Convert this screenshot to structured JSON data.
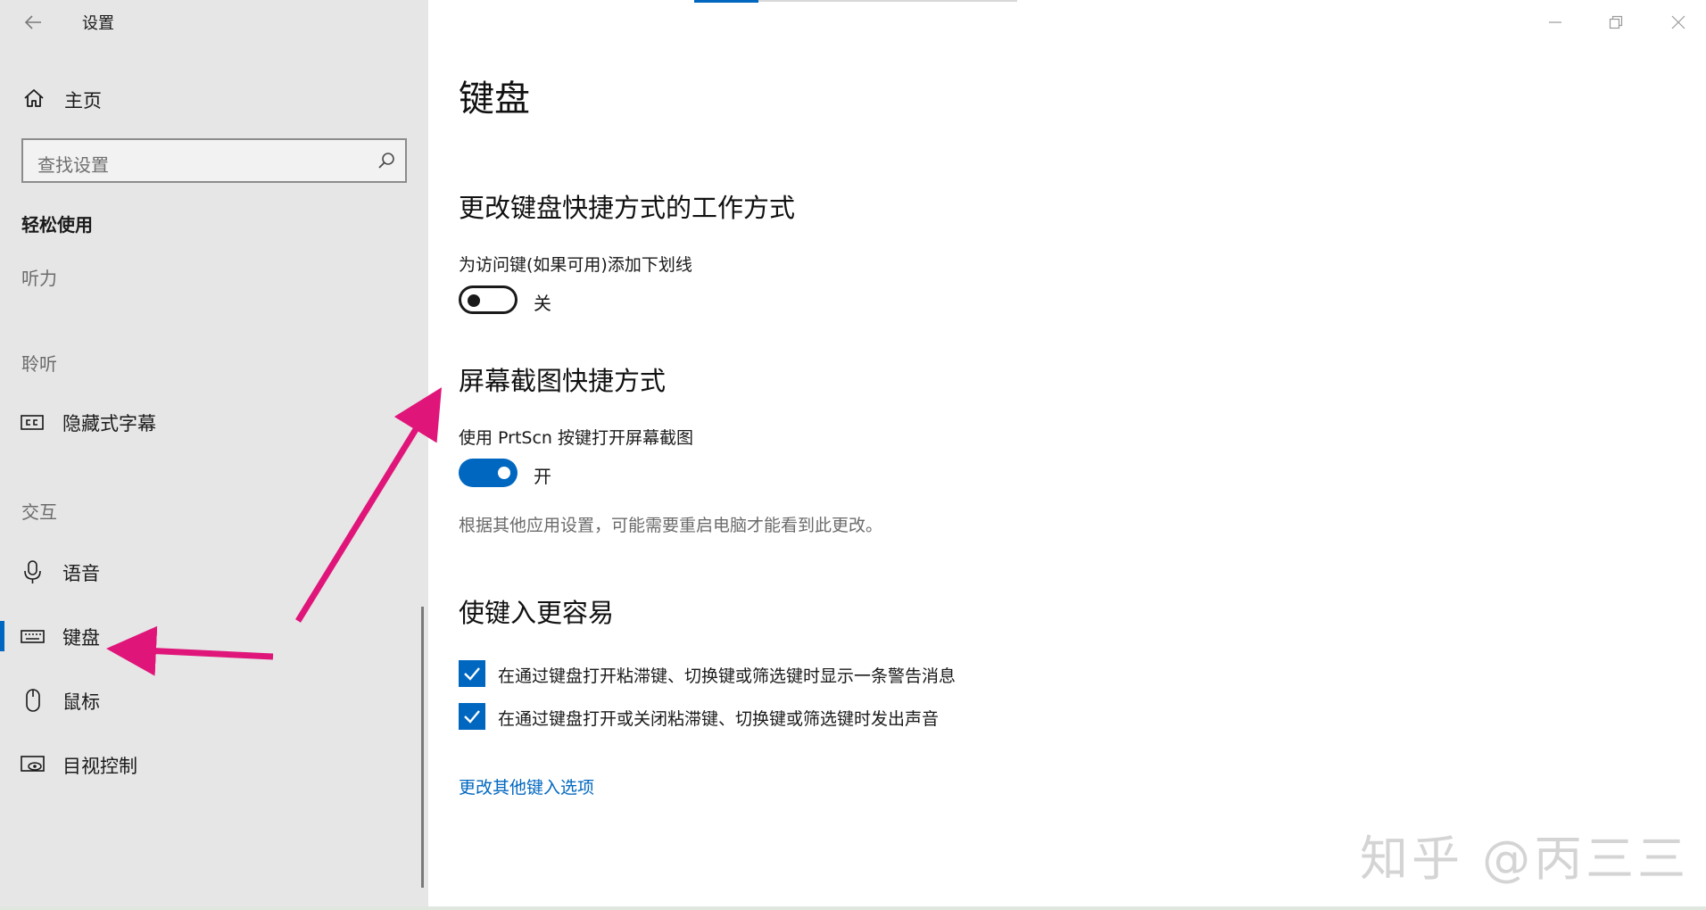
{
  "window": {
    "title": "设置",
    "controls": {
      "minimize": "minimize-icon",
      "restore": "restore-icon",
      "close": "close-icon"
    }
  },
  "sidebar": {
    "home_label": "主页",
    "search": {
      "placeholder": "查找设置"
    },
    "category_title": "轻松使用",
    "groups": {
      "hearing": "听力",
      "listening": "聆听",
      "interaction": "交互"
    },
    "items": [
      {
        "label": "隐藏式字幕",
        "icon": "closed-captions-icon"
      },
      {
        "label": "语音",
        "icon": "microphone-icon"
      },
      {
        "label": "键盘",
        "icon": "keyboard-icon",
        "selected": true
      },
      {
        "label": "鼠标",
        "icon": "mouse-icon"
      },
      {
        "label": "目视控制",
        "icon": "eye-control-icon"
      }
    ]
  },
  "main": {
    "page_title": "键盘",
    "sections": [
      {
        "heading": "更改键盘快捷方式的工作方式",
        "setting_label": "为访问键(如果可用)添加下划线",
        "toggle_state": "关",
        "toggle_on": false
      },
      {
        "heading": "屏幕截图快捷方式",
        "setting_label": "使用 PrtScn 按键打开屏幕截图",
        "toggle_state": "开",
        "toggle_on": true,
        "note": "根据其他应用设置，可能需要重启电脑才能看到此更改。"
      },
      {
        "heading": "使键入更容易",
        "checkboxes": [
          {
            "label": "在通过键盘打开粘滞键、切换键或筛选键时显示一条警告消息",
            "checked": true
          },
          {
            "label": "在通过键盘打开或关闭粘滞键、切换键或筛选键时发出声音",
            "checked": true
          }
        ],
        "link": "更改其他键入选项"
      }
    ]
  },
  "overlay": {
    "watermark": "知乎 @丙三三",
    "arrow_color": "#e0157a"
  },
  "colors": {
    "accent": "#0067c0",
    "sidebar_bg": "#e6e6e6"
  }
}
